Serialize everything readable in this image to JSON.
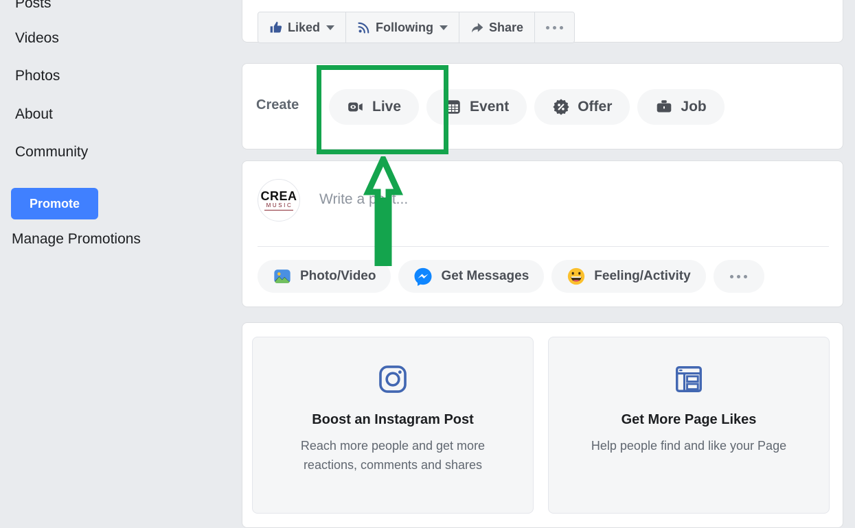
{
  "colors": {
    "page_bg": "#e9ebee",
    "card_bg": "#ffffff",
    "accent_blue": "#4080ff",
    "fb_blue": "#4267b2",
    "annotation_green": "#14a44d",
    "text_primary": "#1c1e21",
    "text_secondary": "#606770",
    "pill_bg": "#f5f6f7"
  },
  "sidebar": {
    "items": [
      {
        "label": "Posts",
        "name": "posts"
      },
      {
        "label": "Videos",
        "name": "videos"
      },
      {
        "label": "Photos",
        "name": "photos"
      },
      {
        "label": "About",
        "name": "about"
      },
      {
        "label": "Community",
        "name": "community"
      }
    ],
    "promote_button": "Promote",
    "manage_promotions": "Manage Promotions"
  },
  "action_bar": {
    "liked": {
      "label": "Liked",
      "icon": "thumbs-up-icon",
      "has_caret": true
    },
    "following": {
      "label": "Following",
      "icon": "rss-icon",
      "has_caret": true
    },
    "share": {
      "label": "Share",
      "icon": "share-arrow-icon",
      "has_caret": false
    },
    "more": {
      "label": "",
      "icon": "ellipsis-icon"
    }
  },
  "create": {
    "label": "Create",
    "buttons": [
      {
        "label": "Live",
        "icon": "video-camera-icon"
      },
      {
        "label": "Event",
        "icon": "calendar-icon"
      },
      {
        "label": "Offer",
        "icon": "percent-badge-icon"
      },
      {
        "label": "Job",
        "icon": "briefcase-icon"
      }
    ]
  },
  "composer": {
    "avatar": {
      "line1": "CREA",
      "line2": "MUSIC",
      "name": "page-avatar"
    },
    "placeholder": "Write a post...",
    "actions": [
      {
        "label": "Photo/Video",
        "icon": "photo-video-icon"
      },
      {
        "label": "Get Messages",
        "icon": "messenger-icon"
      },
      {
        "label": "Feeling/Activity",
        "icon": "smiley-icon"
      }
    ],
    "more_icon": "ellipsis-icon"
  },
  "promos": [
    {
      "title": "Boost an Instagram Post",
      "subtitle": "Reach more people and get more reactions, comments and shares",
      "icon": "instagram-icon"
    },
    {
      "title": "Get More Page Likes",
      "subtitle": "Help people find and like your Page",
      "icon": "page-layout-icon"
    }
  ],
  "annotation": {
    "type": "highlight-box-with-arrow",
    "target": "Live",
    "color": "#14a44d"
  }
}
